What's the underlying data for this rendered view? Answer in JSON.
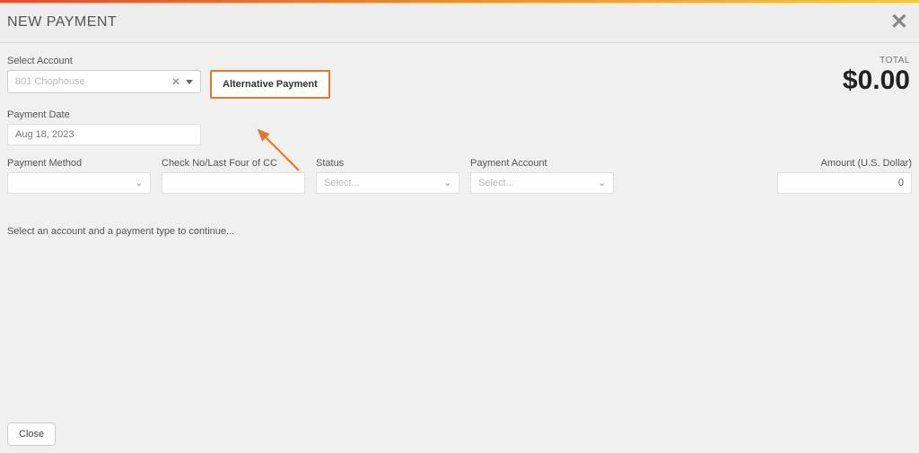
{
  "header": {
    "title": "NEW PAYMENT"
  },
  "account": {
    "label": "Select Account",
    "value": "801 Chophouse"
  },
  "altPaymentBtn": "Alternative Payment",
  "paymentDate": {
    "label": "Payment Date",
    "value": "Aug 18, 2023"
  },
  "total": {
    "label": "TOTAL",
    "amount": "$0.00"
  },
  "fields": {
    "paymentMethod": {
      "label": "Payment Method"
    },
    "checkNo": {
      "label": "Check No/Last Four of CC"
    },
    "status": {
      "label": "Status",
      "placeholder": "Select..."
    },
    "paymentAccount": {
      "label": "Payment Account",
      "placeholder": "Select..."
    },
    "amount": {
      "label": "Amount (U.S. Dollar)",
      "value": "0"
    }
  },
  "continueMsg": "Select an account and a payment type to continue...",
  "footer": {
    "close": "Close"
  }
}
